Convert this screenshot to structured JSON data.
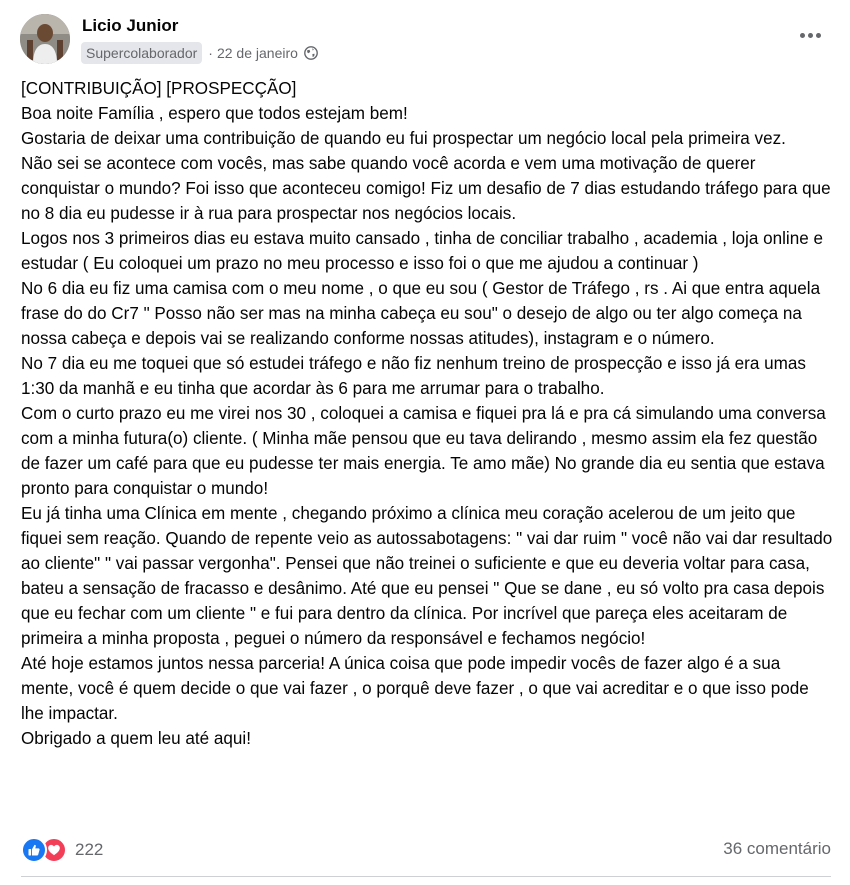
{
  "post": {
    "author": "Licio Junior",
    "badge": "Supercolaborador",
    "separator": "·",
    "date": "22 de janeiro",
    "privacy_icon": "globe-icon",
    "more_icon": "more-options-icon",
    "paragraphs": [
      "[CONTRIBUIÇÃO] [PROSPECÇÃO]",
      "Boa noite Família , espero que todos estejam bem!",
      "Gostaria de deixar uma contribuição de quando eu fui prospectar um negócio local pela primeira vez.",
      "Não sei se acontece com vocês, mas sabe quando você acorda e vem uma motivação de querer conquistar o mundo? Foi isso que aconteceu comigo! Fiz um desafio de 7 dias estudando tráfego para que no 8 dia eu pudesse ir à rua para prospectar nos negócios locais.",
      "Logos nos 3 primeiros dias eu estava muito cansado , tinha de conciliar trabalho , academia , loja online e estudar ( Eu coloquei um prazo no meu processo e isso foi o que me ajudou a continuar )",
      "No 6 dia eu fiz uma camisa com o meu nome , o que eu sou ( Gestor de Tráfego , rs . Ai que entra aquela frase do do Cr7 \" Posso não ser mas na minha cabeça eu sou\" o desejo de algo ou ter algo começa na nossa cabeça e depois vai se realizando conforme nossas atitudes), instagram e o número.",
      "No 7 dia eu me toquei que só estudei tráfego e não fiz nenhum treino de prospecção e isso já era umas 1:30 da manhã e eu tinha que acordar às 6 para me arrumar para o trabalho.",
      "Com o curto prazo eu me virei nos 30 , coloquei a camisa e fiquei pra lá e pra cá simulando uma conversa com a minha futura(o) cliente. ( Minha mãe pensou que eu tava delirando , mesmo assim ela fez questão de fazer um café para que eu pudesse ter mais energia. Te amo mãe) No grande dia eu sentia que estava pronto para conquistar o mundo!",
      "Eu já tinha uma Clínica em mente , chegando próximo a clínica meu coração acelerou de um jeito que fiquei sem reação. Quando de repente veio as autossabotagens: \" vai dar ruim \" você não vai dar resultado ao cliente\" \" vai passar vergonha\". Pensei que não treinei o suficiente e que eu deveria voltar para casa, bateu a sensação de fracasso e desânimo. Até que eu pensei \" Que se dane , eu só volto pra casa depois que eu fechar com um cliente \" e fui para dentro da clínica. Por incrível que pareça eles aceitaram de primeira a minha proposta , peguei o número da responsável e fechamos negócio!",
      "Até hoje estamos juntos nessa parceria! A única coisa que pode impedir vocês de fazer algo é a sua mente, você é quem decide o que vai fazer , o porquê deve fazer , o que vai acreditar e o que isso pode lhe impactar.",
      "Obrigado a quem leu até aqui!"
    ],
    "reactions": {
      "icons": [
        "like-icon",
        "love-icon"
      ],
      "count": "222"
    },
    "comments_label": "36 comentário",
    "colors": {
      "text": "#050505",
      "secondary": "#65676b",
      "badge_bg": "#e4e6eb",
      "like": "#1877f2",
      "love": "#f33e58",
      "divider": "#ced0d4"
    }
  }
}
